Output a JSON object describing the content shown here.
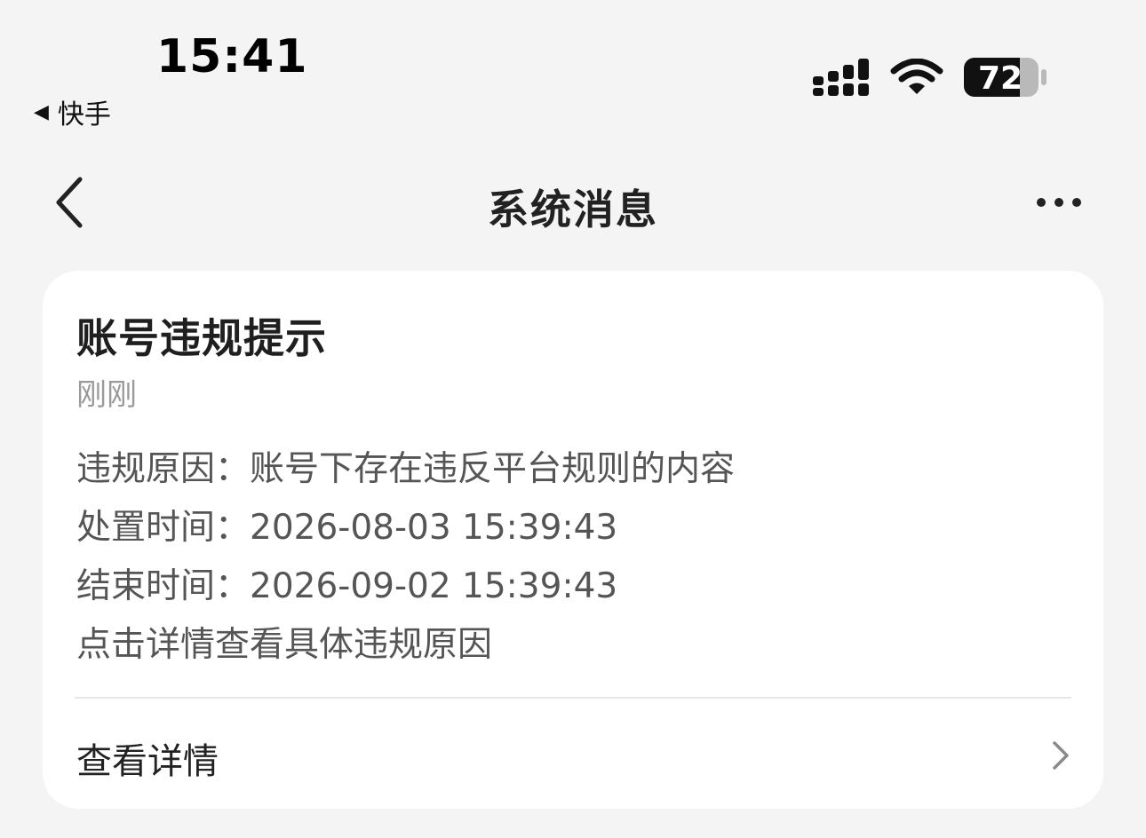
{
  "status_bar": {
    "time": "15:41",
    "back_app_label": "快手",
    "back_app_icon": "triangle-left-icon",
    "battery_level": "72"
  },
  "nav": {
    "title": "系统消息",
    "back_icon": "chevron-left-icon",
    "more_icon": "more-horizontal-icon"
  },
  "message": {
    "title": "账号违规提示",
    "time": "刚刚",
    "lines": [
      "违规原因：账号下存在违反平台规则的内容",
      "处置时间：2026-08-03 15:39:43",
      "结束时间：2026-09-02 15:39:43",
      "点击详情查看具体违规原因"
    ],
    "detail_label": "查看详情",
    "detail_icon": "chevron-right-icon"
  }
}
